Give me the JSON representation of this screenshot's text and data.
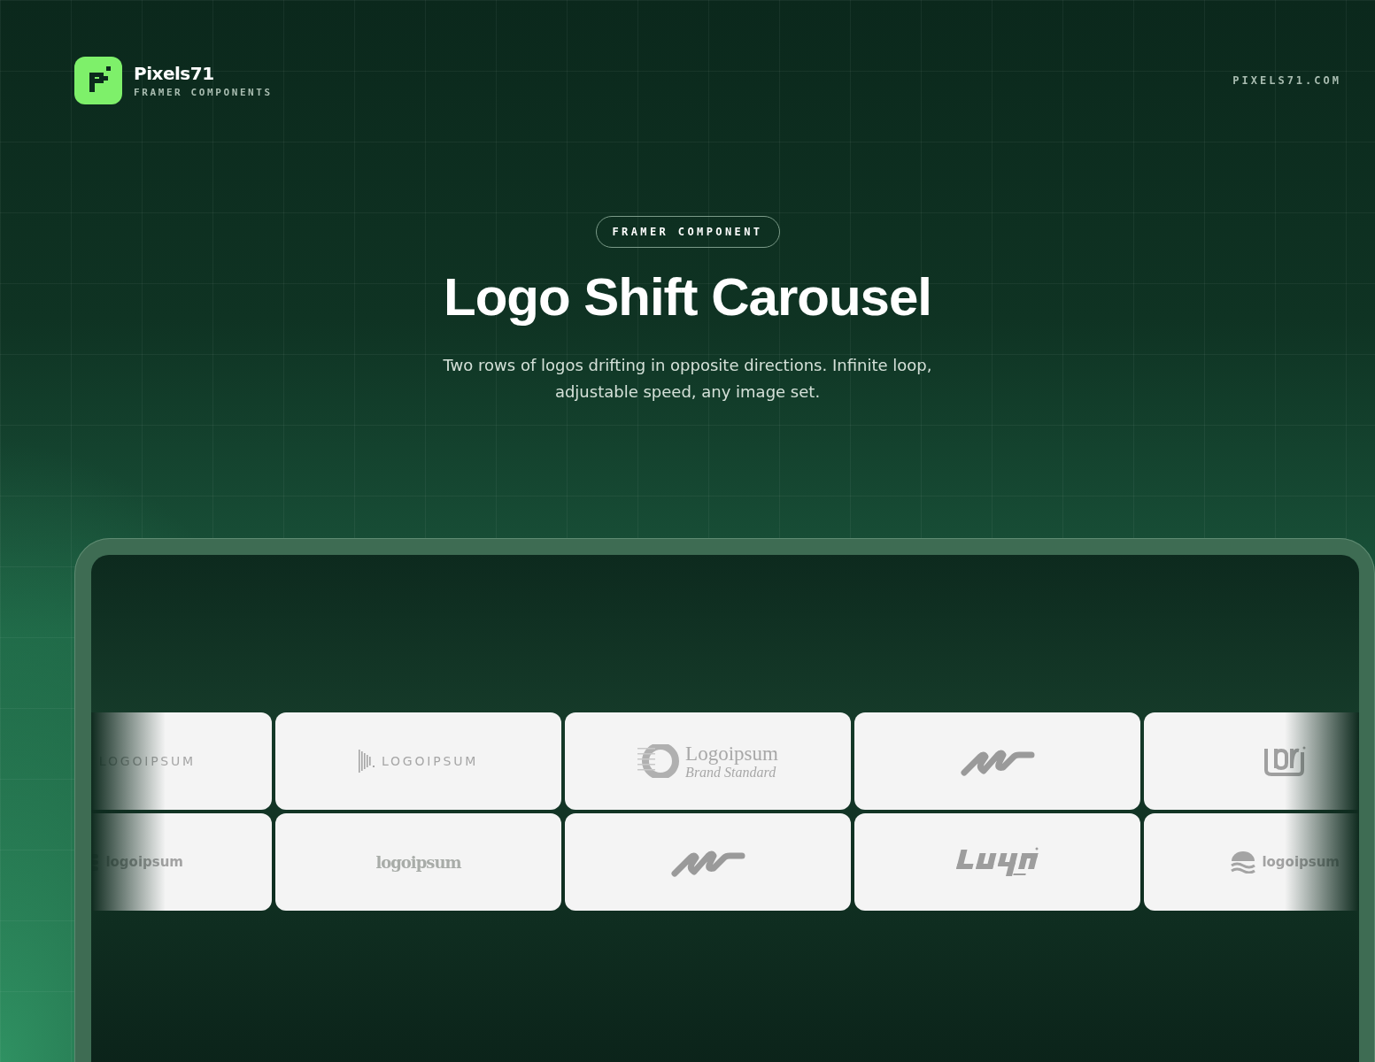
{
  "brand": {
    "name": "Pixels71",
    "tagline": "FRAMER COMPONENTS"
  },
  "site_link": "PIXELS71.COM",
  "hero": {
    "badge": "FRAMER COMPONENT",
    "title": "Logo Shift Carousel",
    "subtitle": "Two rows of logos drifting in opposite directions. Infinite loop, adjustable speed, any image set."
  },
  "carousel": {
    "rows": [
      {
        "cards": [
          {
            "kind": "spaced",
            "text": "LOGOIPSUM"
          },
          {
            "kind": "spaced",
            "text": "LOGOIPSUM"
          },
          {
            "kind": "serif",
            "text": "Logoipsum",
            "sub": "Brand Standard"
          },
          {
            "kind": "wave"
          },
          {
            "kind": "monogram"
          }
        ]
      },
      {
        "cards": [
          {
            "kind": "rounded",
            "text": "logoipsum"
          },
          {
            "kind": "gothic",
            "text": "logoipsum"
          },
          {
            "kind": "wave"
          },
          {
            "kind": "slanted"
          },
          {
            "kind": "stacked",
            "text": "logoipsum"
          }
        ]
      }
    ]
  }
}
